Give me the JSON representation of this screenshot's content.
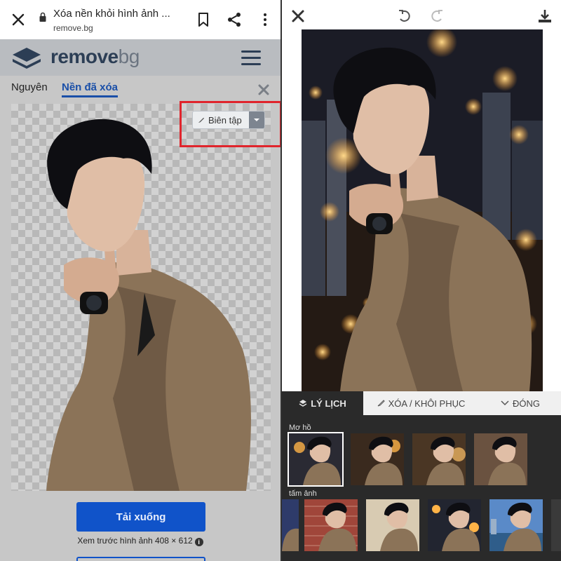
{
  "browser": {
    "title": "Xóa nền khỏi hình ảnh ...",
    "domain": "remove.bg"
  },
  "site": {
    "logo_main": "remove",
    "logo_suffix": "bg"
  },
  "tabs": {
    "original": "Nguyên",
    "removed": "Nền đã xóa"
  },
  "editor_button": {
    "label": "Biên tập"
  },
  "download": {
    "label": "Tải xuống",
    "preview_text": "Xem trước hình ảnh 408 × 612"
  },
  "editor": {
    "tabs": {
      "background": "LÝ LỊCH",
      "erase_restore": "XÓA / KHÔI PHỤC",
      "close": "ĐÓNG"
    },
    "sections": {
      "blur": "Mơ hồ",
      "photos": "tấm ảnh"
    }
  },
  "colors": {
    "accent_blue": "#1053c9",
    "highlight_red": "#e0242c",
    "suit": "#8b7358",
    "hair": "#0e0e12"
  }
}
